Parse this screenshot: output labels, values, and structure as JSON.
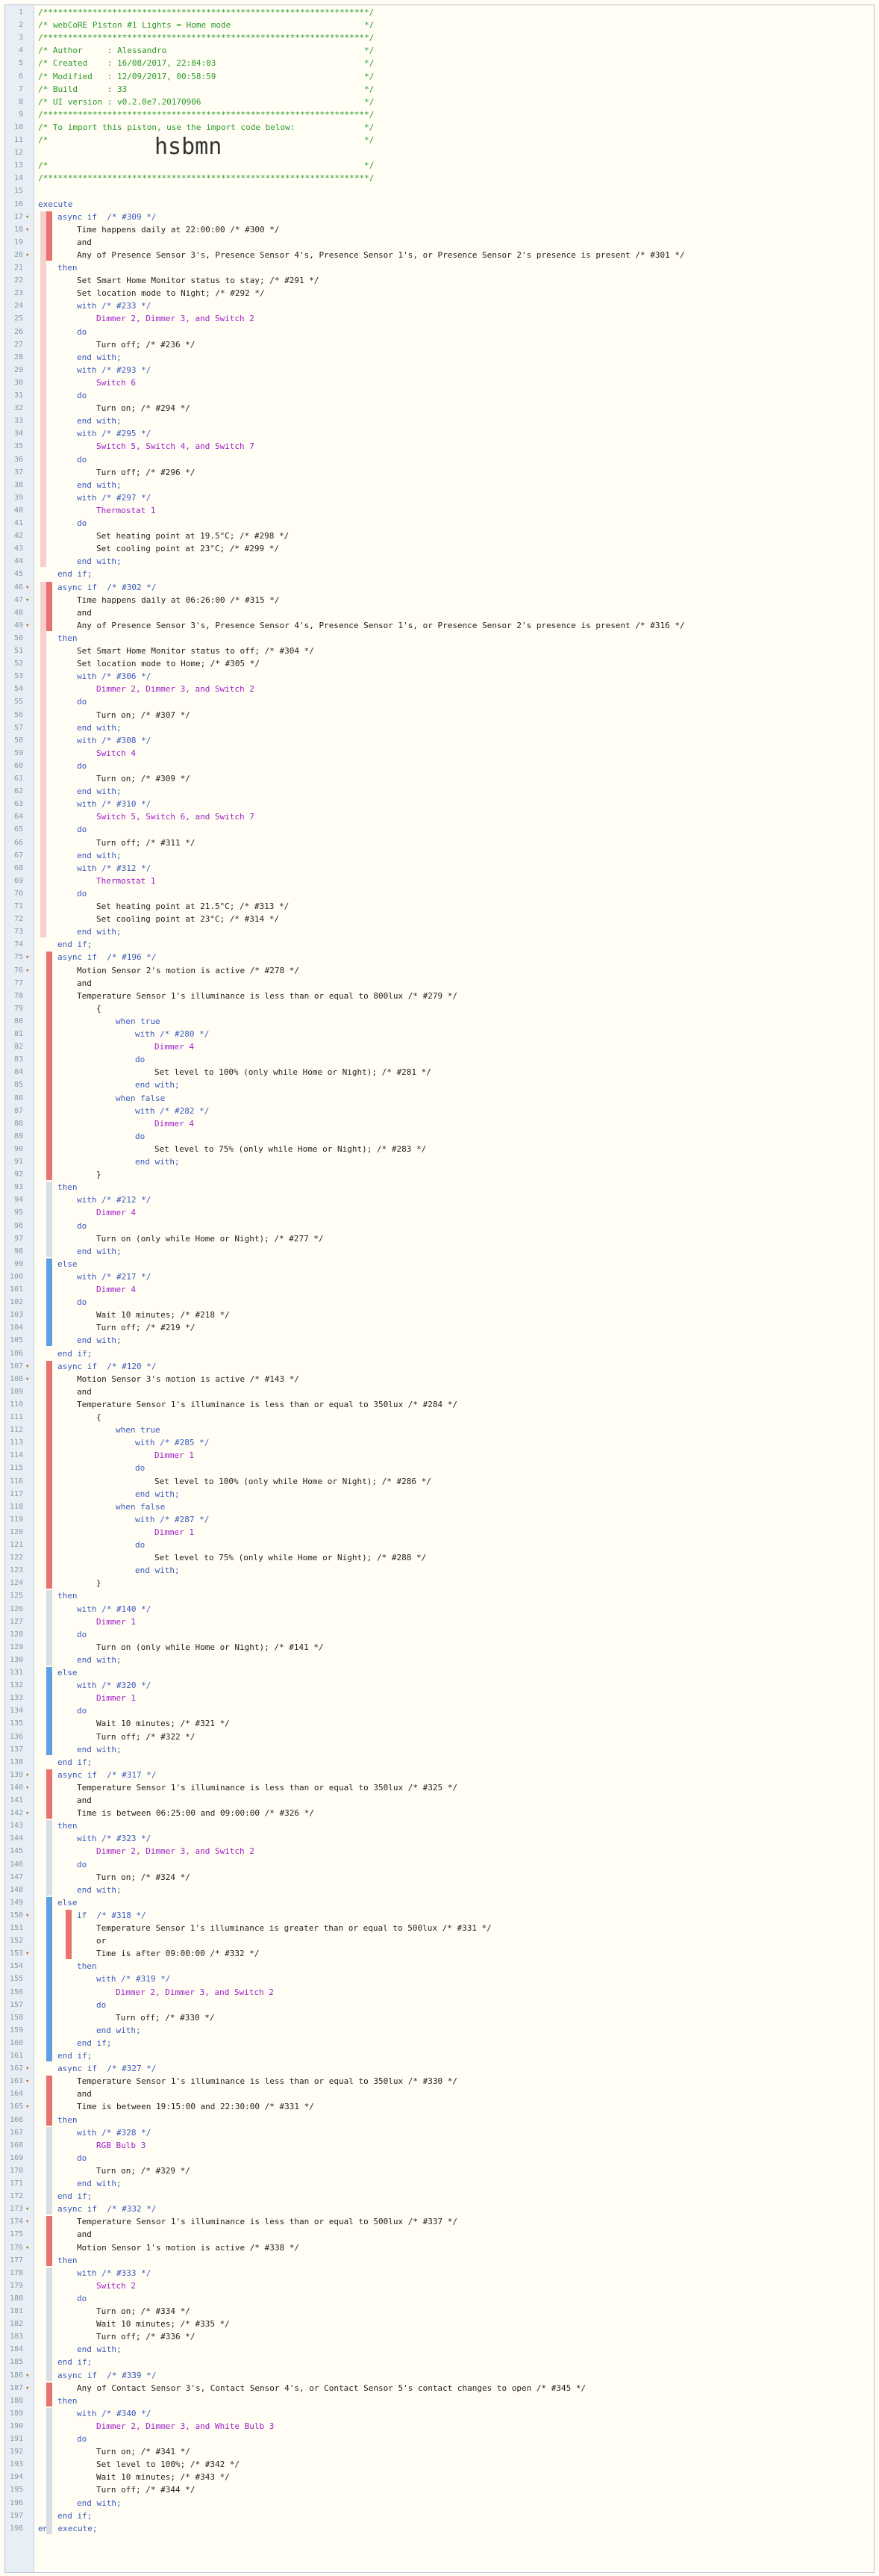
{
  "window": {
    "title": "webCoRE Piston #1 Lights = Home mode"
  },
  "lines": [
    {
      "t": "/******************************************************************/",
      "c": "cm"
    },
    {
      "t": "/* webCoRE Piston #1 Lights = Home mode                           */",
      "c": "cm"
    },
    {
      "t": "/******************************************************************/",
      "c": "cm"
    },
    {
      "t": "/* Author     : Alessandro                                        */",
      "c": "cm"
    },
    {
      "t": "/* Created    : 16/08/2017, 22:04:03                              */",
      "c": "cm"
    },
    {
      "t": "/* Modified   : 12/09/2017, 00:58:59                              */",
      "c": "cm"
    },
    {
      "t": "/* Build      : 33                                                */",
      "c": "cm"
    },
    {
      "t": "/* UI version : v0.2.0e7.20170906                                 */",
      "c": "cm"
    },
    {
      "t": "/******************************************************************/",
      "c": "cm"
    },
    {
      "t": "/* To import this piston, use the import code below:              */",
      "c": "cm"
    },
    {
      "t": "/*                                                                */",
      "c": "cm"
    },
    {
      "t": "hsbmn",
      "c": "big"
    },
    {
      "t": "/*                                                                */",
      "c": "cm"
    },
    {
      "t": "/******************************************************************/",
      "c": "cm"
    },
    {
      "t": "",
      "c": ""
    },
    {
      "t": "execute",
      "c": "kw"
    },
    {
      "t": "async if  /* #309 */",
      "c": "kw",
      "i": 1,
      "fold": 1
    },
    {
      "t": "Time happens daily at 22:00:00 /* #300 */",
      "c": "",
      "i": 2,
      "fold": 1
    },
    {
      "t": "and",
      "c": "",
      "i": 2
    },
    {
      "t": "Any of Presence Sensor 3's, Presence Sensor 4's, Presence Sensor 1's, or Presence Sensor 2's presence is present /* #301 */",
      "c": "",
      "i": 2,
      "fold": 1
    },
    {
      "t": "then",
      "c": "kw",
      "i": 1
    },
    {
      "t": "Set Smart Home Monitor status to stay; /* #291 */",
      "c": "",
      "i": 2
    },
    {
      "t": "Set location mode to Night; /* #292 */",
      "c": "",
      "i": 2
    },
    {
      "t": "with /* #233 */",
      "c": "kw",
      "i": 2
    },
    {
      "t": "Dimmer 2, Dimmer 3, and Switch 2",
      "c": "dev",
      "i": 3
    },
    {
      "t": "do",
      "c": "kw",
      "i": 2
    },
    {
      "t": "Turn off; /* #236 */",
      "c": "",
      "i": 3
    },
    {
      "t": "end with;",
      "c": "kw",
      "i": 2
    },
    {
      "t": "with /* #293 */",
      "c": "kw",
      "i": 2
    },
    {
      "t": "Switch 6",
      "c": "dev",
      "i": 3
    },
    {
      "t": "do",
      "c": "kw",
      "i": 2
    },
    {
      "t": "Turn on; /* #294 */",
      "c": "",
      "i": 3
    },
    {
      "t": "end with;",
      "c": "kw",
      "i": 2
    },
    {
      "t": "with /* #295 */",
      "c": "kw",
      "i": 2
    },
    {
      "t": "Switch 5, Switch 4, and Switch 7",
      "c": "dev",
      "i": 3
    },
    {
      "t": "do",
      "c": "kw",
      "i": 2
    },
    {
      "t": "Turn off; /* #296 */",
      "c": "",
      "i": 3
    },
    {
      "t": "end with;",
      "c": "kw",
      "i": 2
    },
    {
      "t": "with /* #297 */",
      "c": "kw",
      "i": 2
    },
    {
      "t": "Thermostat 1",
      "c": "dev",
      "i": 3
    },
    {
      "t": "do",
      "c": "kw",
      "i": 2
    },
    {
      "t": "Set heating point at 19.5°C; /* #298 */",
      "c": "",
      "i": 3
    },
    {
      "t": "Set cooling point at 23°C; /* #299 */",
      "c": "",
      "i": 3
    },
    {
      "t": "end with;",
      "c": "kw",
      "i": 2
    },
    {
      "t": "end if;",
      "c": "kw",
      "i": 1
    },
    {
      "t": "async if  /* #302 */",
      "c": "kw",
      "i": 1,
      "fold": 1
    },
    {
      "t": "Time happens daily at 06:26:00 /* #315 */",
      "c": "",
      "i": 2,
      "fold": 1
    },
    {
      "t": "and",
      "c": "",
      "i": 2
    },
    {
      "t": "Any of Presence Sensor 3's, Presence Sensor 4's, Presence Sensor 1's, or Presence Sensor 2's presence is present /* #316 */",
      "c": "",
      "i": 2,
      "fold": 1
    },
    {
      "t": "then",
      "c": "kw",
      "i": 1
    },
    {
      "t": "Set Smart Home Monitor status to off; /* #304 */",
      "c": "",
      "i": 2
    },
    {
      "t": "Set location mode to Home; /* #305 */",
      "c": "",
      "i": 2
    },
    {
      "t": "with /* #306 */",
      "c": "kw",
      "i": 2
    },
    {
      "t": "Dimmer 2, Dimmer 3, and Switch 2",
      "c": "dev",
      "i": 3
    },
    {
      "t": "do",
      "c": "kw",
      "i": 2
    },
    {
      "t": "Turn on; /* #307 */",
      "c": "",
      "i": 3
    },
    {
      "t": "end with;",
      "c": "kw",
      "i": 2
    },
    {
      "t": "with /* #308 */",
      "c": "kw",
      "i": 2
    },
    {
      "t": "Switch 4",
      "c": "dev",
      "i": 3
    },
    {
      "t": "do",
      "c": "kw",
      "i": 2
    },
    {
      "t": "Turn on; /* #309 */",
      "c": "",
      "i": 3
    },
    {
      "t": "end with;",
      "c": "kw",
      "i": 2
    },
    {
      "t": "with /* #310 */",
      "c": "kw",
      "i": 2
    },
    {
      "t": "Switch 5, Switch 6, and Switch 7",
      "c": "dev",
      "i": 3
    },
    {
      "t": "do",
      "c": "kw",
      "i": 2
    },
    {
      "t": "Turn off; /* #311 */",
      "c": "",
      "i": 3
    },
    {
      "t": "end with;",
      "c": "kw",
      "i": 2
    },
    {
      "t": "with /* #312 */",
      "c": "kw",
      "i": 2
    },
    {
      "t": "Thermostat 1",
      "c": "dev",
      "i": 3
    },
    {
      "t": "do",
      "c": "kw",
      "i": 2
    },
    {
      "t": "Set heating point at 21.5°C; /* #313 */",
      "c": "",
      "i": 3
    },
    {
      "t": "Set cooling point at 23°C; /* #314 */",
      "c": "",
      "i": 3
    },
    {
      "t": "end with;",
      "c": "kw",
      "i": 2
    },
    {
      "t": "end if;",
      "c": "kw",
      "i": 1
    },
    {
      "t": "async if  /* #196 */",
      "c": "kw",
      "i": 1,
      "fold": 1
    },
    {
      "t": "Motion Sensor 2's motion is active /* #278 */",
      "c": "",
      "i": 2,
      "fold": 1
    },
    {
      "t": "and",
      "c": "",
      "i": 2
    },
    {
      "t": "Temperature Sensor 1's illuminance is less than or equal to 800lux /* #279 */",
      "c": "",
      "i": 2
    },
    {
      "t": "{",
      "c": "",
      "i": 3
    },
    {
      "t": "when true",
      "c": "kw",
      "i": 4
    },
    {
      "t": "with /* #280 */",
      "c": "kw",
      "i": 5
    },
    {
      "t": "Dimmer 4",
      "c": "dev",
      "i": 6
    },
    {
      "t": "do",
      "c": "kw",
      "i": 5
    },
    {
      "t": "Set level to 100% (only while Home or Night); /* #281 */",
      "c": "",
      "i": 6
    },
    {
      "t": "end with;",
      "c": "kw",
      "i": 5
    },
    {
      "t": "when false",
      "c": "kw",
      "i": 4
    },
    {
      "t": "with /* #282 */",
      "c": "kw",
      "i": 5
    },
    {
      "t": "Dimmer 4",
      "c": "dev",
      "i": 6
    },
    {
      "t": "do",
      "c": "kw",
      "i": 5
    },
    {
      "t": "Set level to 75% (only while Home or Night); /* #283 */",
      "c": "",
      "i": 6
    },
    {
      "t": "end with;",
      "c": "kw",
      "i": 5
    },
    {
      "t": "}",
      "c": "",
      "i": 3
    },
    {
      "t": "then",
      "c": "kw",
      "i": 1
    },
    {
      "t": "with /* #212 */",
      "c": "kw",
      "i": 2
    },
    {
      "t": "Dimmer 4",
      "c": "dev",
      "i": 3
    },
    {
      "t": "do",
      "c": "kw",
      "i": 2
    },
    {
      "t": "Turn on (only while Home or Night); /* #277 */",
      "c": "",
      "i": 3
    },
    {
      "t": "end with;",
      "c": "kw",
      "i": 2
    },
    {
      "t": "else",
      "c": "kw",
      "i": 1
    },
    {
      "t": "with /* #217 */",
      "c": "kw",
      "i": 2
    },
    {
      "t": "Dimmer 4",
      "c": "dev",
      "i": 3
    },
    {
      "t": "do",
      "c": "kw",
      "i": 2
    },
    {
      "t": "Wait 10 minutes; /* #218 */",
      "c": "",
      "i": 3
    },
    {
      "t": "Turn off; /* #219 */",
      "c": "",
      "i": 3
    },
    {
      "t": "end with;",
      "c": "kw",
      "i": 2
    },
    {
      "t": "end if;",
      "c": "kw",
      "i": 1
    },
    {
      "t": "async if  /* #120 */",
      "c": "kw",
      "i": 1,
      "fold": 1
    },
    {
      "t": "Motion Sensor 3's motion is active /* #143 */",
      "c": "",
      "i": 2,
      "fold": 1
    },
    {
      "t": "and",
      "c": "",
      "i": 2
    },
    {
      "t": "Temperature Sensor 1's illuminance is less than or equal to 350lux /* #284 */",
      "c": "",
      "i": 2
    },
    {
      "t": "{",
      "c": "",
      "i": 3
    },
    {
      "t": "when true",
      "c": "kw",
      "i": 4
    },
    {
      "t": "with /* #285 */",
      "c": "kw",
      "i": 5
    },
    {
      "t": "Dimmer 1",
      "c": "dev",
      "i": 6
    },
    {
      "t": "do",
      "c": "kw",
      "i": 5
    },
    {
      "t": "Set level to 100% (only while Home or Night); /* #286 */",
      "c": "",
      "i": 6
    },
    {
      "t": "end with;",
      "c": "kw",
      "i": 5
    },
    {
      "t": "when false",
      "c": "kw",
      "i": 4
    },
    {
      "t": "with /* #287 */",
      "c": "kw",
      "i": 5
    },
    {
      "t": "Dimmer 1",
      "c": "dev",
      "i": 6
    },
    {
      "t": "do",
      "c": "kw",
      "i": 5
    },
    {
      "t": "Set level to 75% (only while Home or Night); /* #288 */",
      "c": "",
      "i": 6
    },
    {
      "t": "end with;",
      "c": "kw",
      "i": 5
    },
    {
      "t": "}",
      "c": "",
      "i": 3
    },
    {
      "t": "then",
      "c": "kw",
      "i": 1
    },
    {
      "t": "with /* #140 */",
      "c": "kw",
      "i": 2
    },
    {
      "t": "Dimmer 1",
      "c": "dev",
      "i": 3
    },
    {
      "t": "do",
      "c": "kw",
      "i": 2
    },
    {
      "t": "Turn on (only while Home or Night); /* #141 */",
      "c": "",
      "i": 3
    },
    {
      "t": "end with;",
      "c": "kw",
      "i": 2
    },
    {
      "t": "else",
      "c": "kw",
      "i": 1
    },
    {
      "t": "with /* #320 */",
      "c": "kw",
      "i": 2
    },
    {
      "t": "Dimmer 1",
      "c": "dev",
      "i": 3
    },
    {
      "t": "do",
      "c": "kw",
      "i": 2
    },
    {
      "t": "Wait 10 minutes; /* #321 */",
      "c": "",
      "i": 3
    },
    {
      "t": "Turn off; /* #322 */",
      "c": "",
      "i": 3
    },
    {
      "t": "end with;",
      "c": "kw",
      "i": 2
    },
    {
      "t": "end if;",
      "c": "kw",
      "i": 1
    },
    {
      "t": "async if  /* #317 */",
      "c": "kw",
      "i": 1,
      "fold": 1
    },
    {
      "t": "Temperature Sensor 1's illuminance is less than or equal to 350lux /* #325 */",
      "c": "",
      "i": 2,
      "fold": 1
    },
    {
      "t": "and",
      "c": "",
      "i": 2
    },
    {
      "t": "Time is between 06:25:00 and 09:00:00 /* #326 */",
      "c": "",
      "i": 2,
      "fold": 1
    },
    {
      "t": "then",
      "c": "kw",
      "i": 1
    },
    {
      "t": "with /* #323 */",
      "c": "kw",
      "i": 2
    },
    {
      "t": "Dimmer 2, Dimmer 3, and Switch 2",
      "c": "dev",
      "i": 3
    },
    {
      "t": "do",
      "c": "kw",
      "i": 2
    },
    {
      "t": "Turn on; /* #324 */",
      "c": "",
      "i": 3
    },
    {
      "t": "end with;",
      "c": "kw",
      "i": 2
    },
    {
      "t": "else",
      "c": "kw",
      "i": 1
    },
    {
      "t": "if  /* #318 */",
      "c": "kw",
      "i": 2,
      "fold": 1
    },
    {
      "t": "Temperature Sensor 1's illuminance is greater than or equal to 500lux /* #331 */",
      "c": "",
      "i": 3
    },
    {
      "t": "or",
      "c": "",
      "i": 3
    },
    {
      "t": "Time is after 09:00:00 /* #332 */",
      "c": "",
      "i": 3,
      "fold": 1
    },
    {
      "t": "then",
      "c": "kw",
      "i": 2
    },
    {
      "t": "with /* #319 */",
      "c": "kw",
      "i": 3
    },
    {
      "t": "Dimmer 2, Dimmer 3, and Switch 2",
      "c": "dev",
      "i": 4
    },
    {
      "t": "do",
      "c": "kw",
      "i": 3
    },
    {
      "t": "Turn off; /* #330 */",
      "c": "",
      "i": 4
    },
    {
      "t": "end with;",
      "c": "kw",
      "i": 3
    },
    {
      "t": "end if;",
      "c": "kw",
      "i": 2
    },
    {
      "t": "end if;",
      "c": "kw",
      "i": 1
    },
    {
      "t": "async if  /* #327 */",
      "c": "kw",
      "i": 1,
      "fold": 1
    },
    {
      "t": "Temperature Sensor 1's illuminance is less than or equal to 350lux /* #330 */",
      "c": "",
      "i": 2,
      "fold": 1
    },
    {
      "t": "and",
      "c": "",
      "i": 2
    },
    {
      "t": "Time is between 19:15:00 and 22:30:00 /* #331 */",
      "c": "",
      "i": 2,
      "fold": 1
    },
    {
      "t": "then",
      "c": "kw",
      "i": 1
    },
    {
      "t": "with /* #328 */",
      "c": "kw",
      "i": 2
    },
    {
      "t": "RGB Bulb 3",
      "c": "dev",
      "i": 3
    },
    {
      "t": "do",
      "c": "kw",
      "i": 2
    },
    {
      "t": "Turn on; /* #329 */",
      "c": "",
      "i": 3
    },
    {
      "t": "end with;",
      "c": "kw",
      "i": 2
    },
    {
      "t": "end if;",
      "c": "kw",
      "i": 1
    },
    {
      "t": "async if  /* #332 */",
      "c": "kw",
      "i": 1,
      "fold": 1
    },
    {
      "t": "Temperature Sensor 1's illuminance is less than or equal to 500lux /* #337 */",
      "c": "",
      "i": 2,
      "fold": 1
    },
    {
      "t": "and",
      "c": "",
      "i": 2
    },
    {
      "t": "Motion Sensor 1's motion is active /* #338 */",
      "c": "",
      "i": 2,
      "fold": 1
    },
    {
      "t": "then",
      "c": "kw",
      "i": 1
    },
    {
      "t": "with /* #333 */",
      "c": "kw",
      "i": 2
    },
    {
      "t": "Switch 2",
      "c": "dev",
      "i": 3
    },
    {
      "t": "do",
      "c": "kw",
      "i": 2
    },
    {
      "t": "Turn on; /* #334 */",
      "c": "",
      "i": 3
    },
    {
      "t": "Wait 10 minutes; /* #335 */",
      "c": "",
      "i": 3
    },
    {
      "t": "Turn off; /* #336 */",
      "c": "",
      "i": 3
    },
    {
      "t": "end with;",
      "c": "kw",
      "i": 2
    },
    {
      "t": "end if;",
      "c": "kw",
      "i": 1
    },
    {
      "t": "async if  /* #339 */",
      "c": "kw",
      "i": 1,
      "fold": 1
    },
    {
      "t": "Any of Contact Sensor 3's, Contact Sensor 4's, or Contact Sensor 5's contact changes to open /* #345 */",
      "c": "",
      "i": 2,
      "fold": 1
    },
    {
      "t": "then",
      "c": "kw",
      "i": 1
    },
    {
      "t": "with /* #340 */",
      "c": "kw",
      "i": 2
    },
    {
      "t": "Dimmer 2, Dimmer 3, and White Bulb 3",
      "c": "dev",
      "i": 3
    },
    {
      "t": "do",
      "c": "kw",
      "i": 2
    },
    {
      "t": "Turn on; /* #341 */",
      "c": "",
      "i": 3
    },
    {
      "t": "Set level to 100%; /* #342 */",
      "c": "",
      "i": 3
    },
    {
      "t": "Wait 10 minutes; /* #343 */",
      "c": "",
      "i": 3
    },
    {
      "t": "Turn off; /* #344 */",
      "c": "",
      "i": 3
    },
    {
      "t": "end with;",
      "c": "kw",
      "i": 2
    },
    {
      "t": "end if;",
      "c": "kw",
      "i": 1
    },
    {
      "t": "end execute;",
      "c": "kw"
    }
  ]
}
